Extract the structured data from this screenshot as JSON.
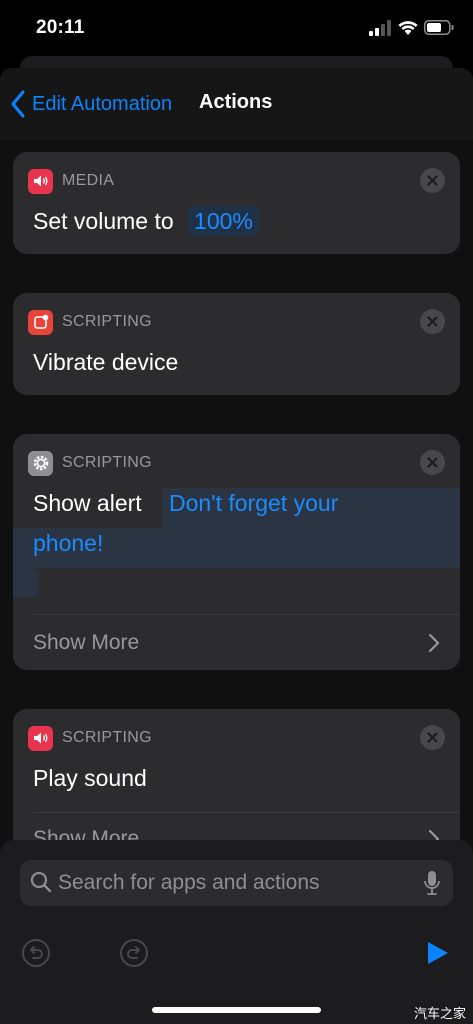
{
  "status_bar": {
    "time": "20:11",
    "icons": [
      "cellular-signal-icon",
      "wifi-icon",
      "battery-icon"
    ]
  },
  "nav": {
    "back_label": "Edit Automation",
    "title": "Actions"
  },
  "actions": [
    {
      "category": "MEDIA",
      "icon": "speaker-volume-icon",
      "icon_color": "#e8344e",
      "text": "Set volume to",
      "token": "100%"
    },
    {
      "category": "SCRIPTING",
      "icon": "vibrate-device-icon",
      "icon_color": "#e8443a",
      "text": "Vibrate device"
    },
    {
      "category": "SCRIPTING",
      "icon": "gear-icon",
      "icon_color": "#8e8e93",
      "text": "Show alert",
      "token_line1": "Don't forget your",
      "token_line2": "phone!",
      "show_more": "Show More"
    },
    {
      "category": "SCRIPTING",
      "icon": "speaker-volume-icon",
      "icon_color": "#e8344e",
      "text": "Play sound",
      "show_more": "Show More"
    }
  ],
  "search": {
    "placeholder": "Search for apps and actions"
  },
  "toolbar": {
    "icons": [
      "undo-icon",
      "redo-icon",
      "play-icon"
    ]
  },
  "watermark": "汽车之家",
  "colors": {
    "accent": "#0a84ff",
    "card": "#2c2c2e",
    "token_bg": "#1f3147"
  }
}
